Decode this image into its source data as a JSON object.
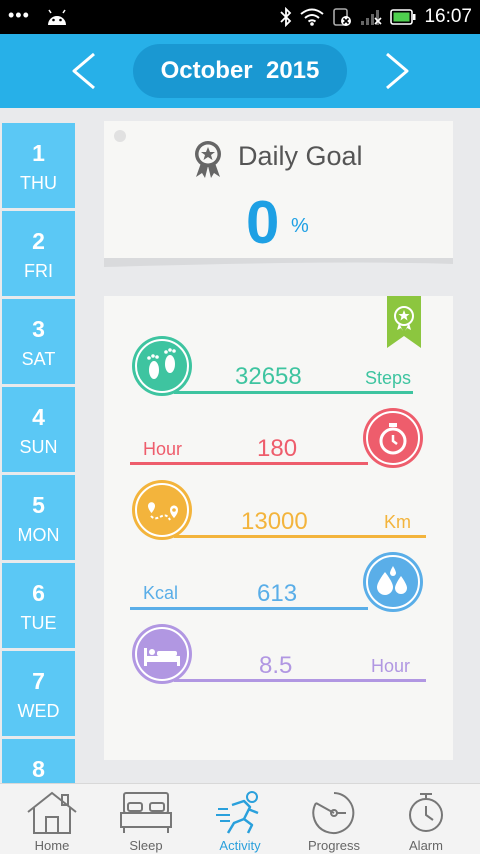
{
  "status_bar": {
    "time": "16:07"
  },
  "header": {
    "month": "October  2015"
  },
  "days": [
    {
      "num": "1",
      "weekday": "THU"
    },
    {
      "num": "2",
      "weekday": "FRI"
    },
    {
      "num": "3",
      "weekday": "SAT"
    },
    {
      "num": "4",
      "weekday": "SUN"
    },
    {
      "num": "5",
      "weekday": "MON"
    },
    {
      "num": "6",
      "weekday": "TUE"
    },
    {
      "num": "7",
      "weekday": "WED"
    },
    {
      "num": "8",
      "weekday": ""
    }
  ],
  "goal": {
    "title": "Daily Goal",
    "value": "0",
    "unit": "%"
  },
  "stats": {
    "steps": {
      "value": "32658",
      "unit": "Steps",
      "color": "#3ec4a0"
    },
    "hour": {
      "value": "180",
      "unit": "Hour",
      "color": "#ee5d6c"
    },
    "distance": {
      "value": "13000",
      "unit": "Km",
      "color": "#f3b43c"
    },
    "kcal": {
      "value": "613",
      "unit": "Kcal",
      "color": "#5aaee8"
    },
    "sleep": {
      "value": "8.5",
      "unit": "Hour",
      "color": "#b197e2"
    }
  },
  "bottom_nav": {
    "home": "Home",
    "sleep": "Sleep",
    "activity": "Activity",
    "progress": "Progress",
    "alarm": "Alarm"
  },
  "colors": {
    "header": "#27b0e8",
    "day_tile": "#5bc8f5",
    "accent": "#1ea0e4"
  }
}
